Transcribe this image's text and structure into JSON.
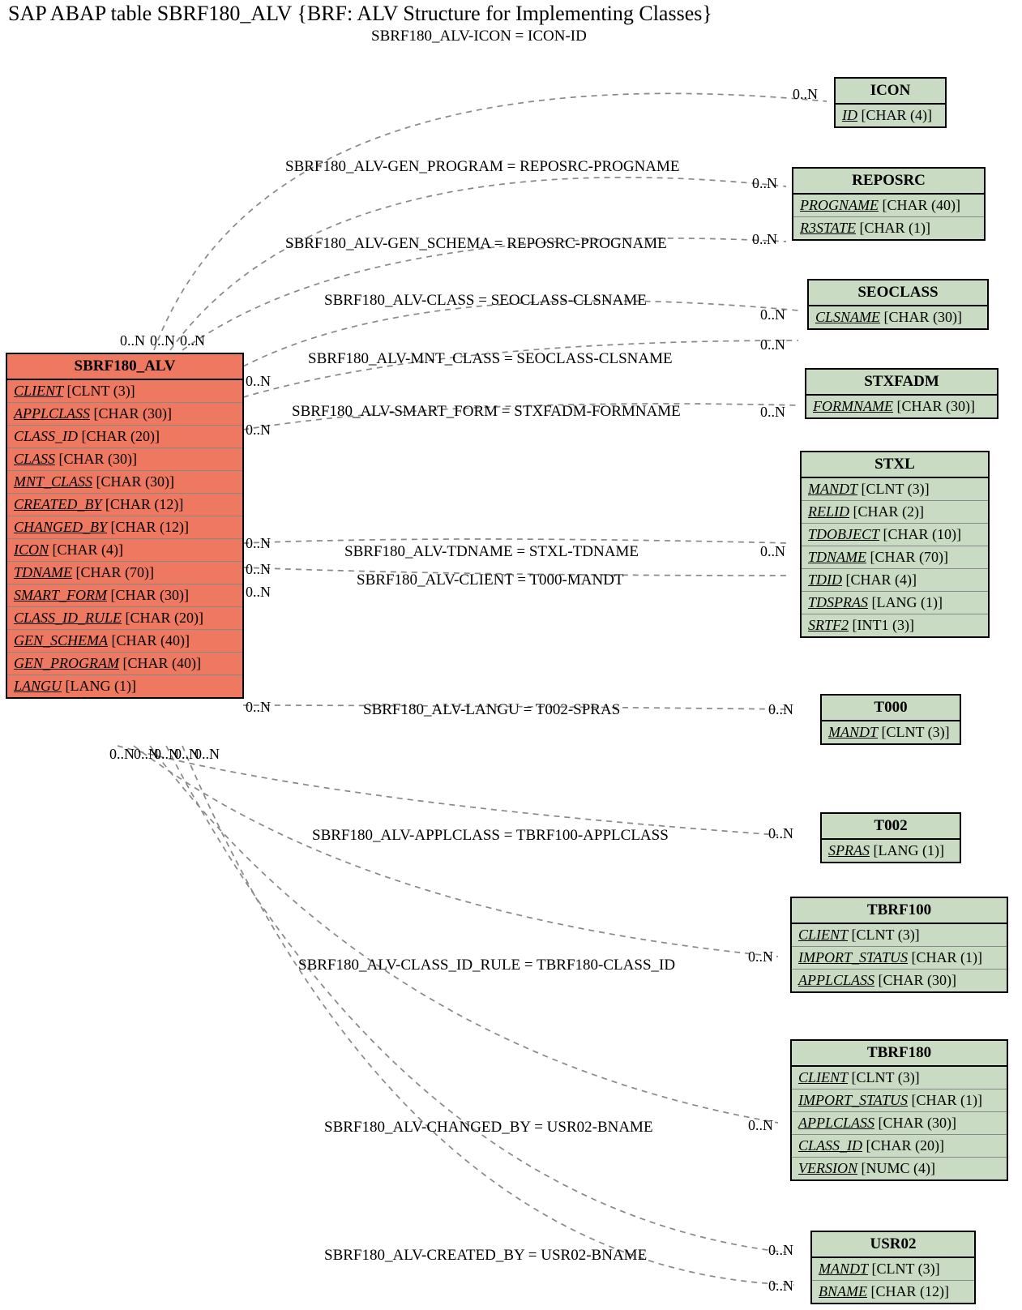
{
  "title": "SAP ABAP table SBRF180_ALV {BRF: ALV Structure for Implementing Classes}",
  "subtitle": "SBRF180_ALV-ICON = ICON-ID",
  "main_entity": {
    "name": "SBRF180_ALV",
    "fields": [
      {
        "name": "CLIENT",
        "type": "[CLNT (3)]"
      },
      {
        "name": "APPLCLASS",
        "type": "[CHAR (30)]"
      },
      {
        "name": "CLASS_ID",
        "type": "[CHAR (20)]",
        "nou": true
      },
      {
        "name": "CLASS",
        "type": "[CHAR (30)]"
      },
      {
        "name": "MNT_CLASS",
        "type": "[CHAR (30)]"
      },
      {
        "name": "CREATED_BY",
        "type": "[CHAR (12)]"
      },
      {
        "name": "CHANGED_BY",
        "type": "[CHAR (12)]"
      },
      {
        "name": "ICON",
        "type": "[CHAR (4)]"
      },
      {
        "name": "TDNAME",
        "type": "[CHAR (70)]"
      },
      {
        "name": "SMART_FORM",
        "type": "[CHAR (30)]"
      },
      {
        "name": "CLASS_ID_RULE",
        "type": "[CHAR (20)]"
      },
      {
        "name": "GEN_SCHEMA",
        "type": "[CHAR (40)]"
      },
      {
        "name": "GEN_PROGRAM",
        "type": "[CHAR (40)]"
      },
      {
        "name": "LANGU",
        "type": "[LANG (1)]"
      }
    ]
  },
  "ref_entities": [
    {
      "name": "ICON",
      "fields": [
        {
          "name": "ID",
          "type": "[CHAR (4)]"
        }
      ]
    },
    {
      "name": "REPOSRC",
      "fields": [
        {
          "name": "PROGNAME",
          "type": "[CHAR (40)]"
        },
        {
          "name": "R3STATE",
          "type": "[CHAR (1)]"
        }
      ]
    },
    {
      "name": "SEOCLASS",
      "fields": [
        {
          "name": "CLSNAME",
          "type": "[CHAR (30)]"
        }
      ]
    },
    {
      "name": "STXFADM",
      "fields": [
        {
          "name": "FORMNAME",
          "type": "[CHAR (30)]"
        }
      ]
    },
    {
      "name": "STXL",
      "fields": [
        {
          "name": "MANDT",
          "type": "[CLNT (3)]"
        },
        {
          "name": "RELID",
          "type": "[CHAR (2)]"
        },
        {
          "name": "TDOBJECT",
          "type": "[CHAR (10)]"
        },
        {
          "name": "TDNAME",
          "type": "[CHAR (70)]"
        },
        {
          "name": "TDID",
          "type": "[CHAR (4)]"
        },
        {
          "name": "TDSPRAS",
          "type": "[LANG (1)]"
        },
        {
          "name": "SRTF2",
          "type": "[INT1 (3)]"
        }
      ]
    },
    {
      "name": "T000",
      "fields": [
        {
          "name": "MANDT",
          "type": "[CLNT (3)]"
        }
      ]
    },
    {
      "name": "T002",
      "fields": [
        {
          "name": "SPRAS",
          "type": "[LANG (1)]"
        }
      ]
    },
    {
      "name": "TBRF100",
      "fields": [
        {
          "name": "CLIENT",
          "type": "[CLNT (3)]"
        },
        {
          "name": "IMPORT_STATUS",
          "type": "[CHAR (1)]"
        },
        {
          "name": "APPLCLASS",
          "type": "[CHAR (30)]"
        }
      ]
    },
    {
      "name": "TBRF180",
      "fields": [
        {
          "name": "CLIENT",
          "type": "[CLNT (3)]"
        },
        {
          "name": "IMPORT_STATUS",
          "type": "[CHAR (1)]"
        },
        {
          "name": "APPLCLASS",
          "type": "[CHAR (30)]"
        },
        {
          "name": "CLASS_ID",
          "type": "[CHAR (20)]"
        },
        {
          "name": "VERSION",
          "type": "[NUMC (4)]"
        }
      ]
    },
    {
      "name": "USR02",
      "fields": [
        {
          "name": "MANDT",
          "type": "[CLNT (3)]"
        },
        {
          "name": "BNAME",
          "type": "[CHAR (12)]"
        }
      ]
    }
  ],
  "relations": [
    "SBRF180_ALV-GEN_PROGRAM = REPOSRC-PROGNAME",
    "SBRF180_ALV-GEN_SCHEMA = REPOSRC-PROGNAME",
    "SBRF180_ALV-CLASS = SEOCLASS-CLSNAME",
    "SBRF180_ALV-MNT_CLASS = SEOCLASS-CLSNAME",
    "SBRF180_ALV-SMART_FORM = STXFADM-FORMNAME",
    "SBRF180_ALV-TDNAME = STXL-TDNAME",
    "SBRF180_ALV-CLIENT = T000-MANDT",
    "SBRF180_ALV-LANGU = T002-SPRAS",
    "SBRF180_ALV-APPLCLASS = TBRF100-APPLCLASS",
    "SBRF180_ALV-CLASS_ID_RULE = TBRF180-CLASS_ID",
    "SBRF180_ALV-CHANGED_BY = USR02-BNAME",
    "SBRF180_ALV-CREATED_BY = USR02-BNAME"
  ],
  "cardinality": "0..N"
}
